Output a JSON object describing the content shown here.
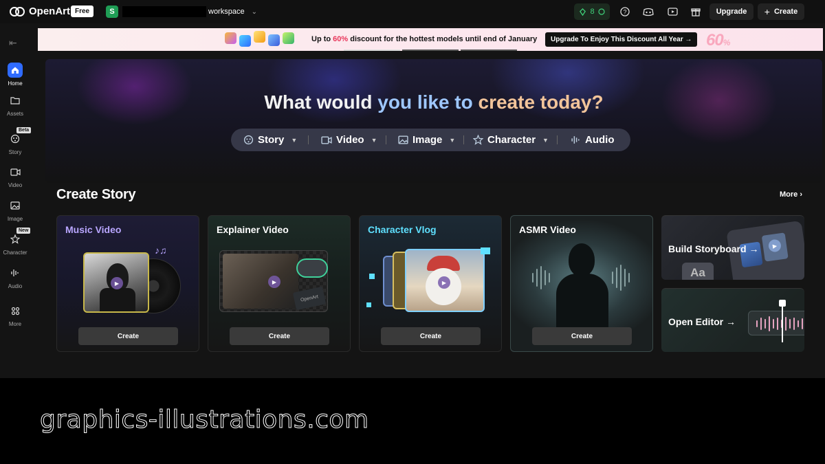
{
  "brand": {
    "name": "OpenArt",
    "plan": "Free"
  },
  "workspace": {
    "avatar": "S",
    "name": "workspace"
  },
  "header": {
    "credits": "8",
    "icons": [
      "help-icon",
      "discord-icon",
      "youtube-icon",
      "gift-icon"
    ],
    "upgrade_label": "Upgrade",
    "create_label": "Create"
  },
  "sidebar": {
    "items": [
      {
        "label": "Home",
        "icon": "home-icon",
        "active": true
      },
      {
        "label": "Assets",
        "icon": "folder-icon"
      },
      {
        "label": "Story",
        "icon": "story-icon",
        "tag": "Beta"
      },
      {
        "label": "Video",
        "icon": "video-icon"
      },
      {
        "label": "Image",
        "icon": "image-icon"
      },
      {
        "label": "Character",
        "icon": "character-icon",
        "tag": "New"
      },
      {
        "label": "Audio",
        "icon": "audio-icon"
      },
      {
        "label": "More",
        "icon": "grid-icon"
      }
    ]
  },
  "promo": {
    "text_prefix": "Up to ",
    "percent": "60%",
    "text_suffix": " discount for the hottest models until end of January",
    "button": "Upgrade To Enjoy This Discount All Year →",
    "big": "60",
    "big_suffix": "%",
    "pagination_active": 0
  },
  "hero": {
    "title_part1": "What would ",
    "title_part2": "you like to ",
    "title_part3": "create today?",
    "tabs": [
      {
        "label": "Story",
        "icon": "story-icon",
        "dropdown": true
      },
      {
        "label": "Video",
        "icon": "video-icon",
        "dropdown": true
      },
      {
        "label": "Image",
        "icon": "image-icon",
        "dropdown": true
      },
      {
        "label": "Character",
        "icon": "character-icon",
        "dropdown": true
      },
      {
        "label": "Audio",
        "icon": "audio-icon",
        "dropdown": false
      }
    ]
  },
  "section": {
    "title": "Create Story",
    "more": "More ›",
    "cards": [
      {
        "title": "Music Video",
        "title_color": "#b9a6ff",
        "button": "Create"
      },
      {
        "title": "Explainer Video",
        "title_color": "#ffffff",
        "button": "Create"
      },
      {
        "title": "Character Vlog",
        "title_color": "#5fe0ff",
        "button": "Create"
      },
      {
        "title": "ASMR Video",
        "title_color": "#ffffff",
        "button": "Create"
      }
    ],
    "side_cards": [
      {
        "title": "Build Storyboard →",
        "thumb_text": "Aa"
      },
      {
        "title": "Open Editor →"
      }
    ]
  },
  "explainer_logo": "OpenArt",
  "watermark": "graphics-illustrations.com"
}
